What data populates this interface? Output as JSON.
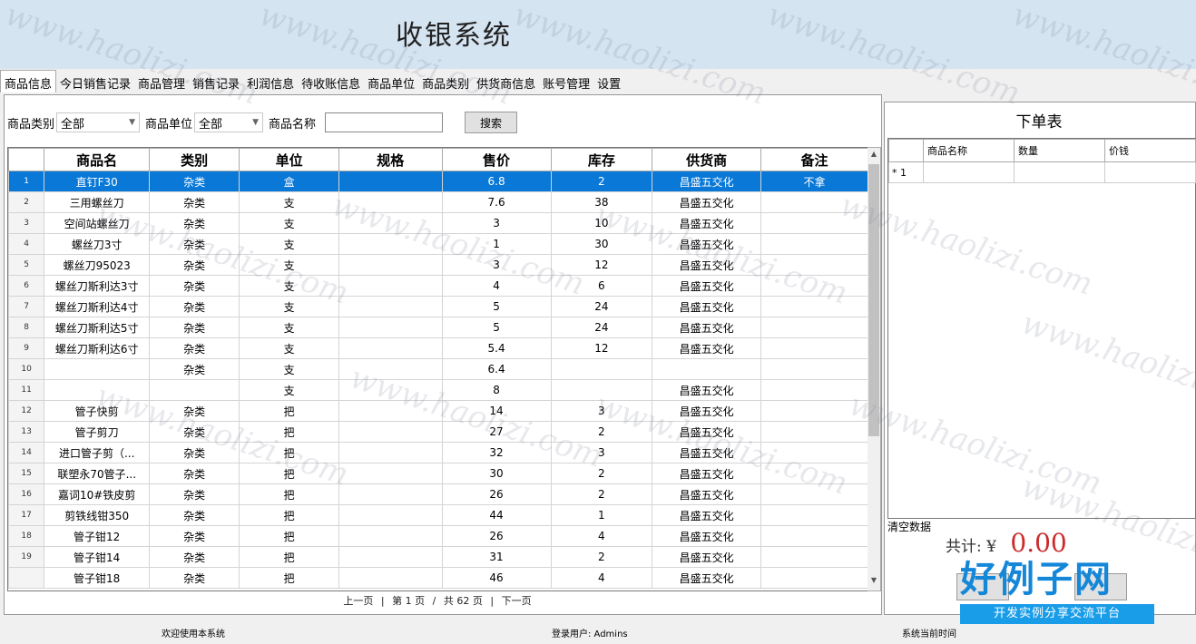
{
  "app": {
    "title": "收银系统"
  },
  "tabs": [
    "商品信息",
    "今日销售记录",
    "商品管理",
    "销售记录",
    "利润信息",
    "待收账信息",
    "商品单位",
    "商品类别",
    "供货商信息",
    "账号管理",
    "设置"
  ],
  "filter": {
    "category_label": "商品类别",
    "category_value": "全部",
    "unit_label": "商品单位",
    "unit_value": "全部",
    "name_label": "商品名称",
    "name_value": "",
    "search_button": "搜索"
  },
  "grid": {
    "columns": [
      "商品名",
      "类别",
      "单位",
      "规格",
      "售价",
      "库存",
      "供货商",
      "备注"
    ],
    "rows": [
      {
        "num": "1",
        "name": "直钉F30",
        "category": "杂类",
        "unit": "盒",
        "spec": "",
        "price": "6.8",
        "stock": "2",
        "supplier": "昌盛五交化",
        "note": "不拿",
        "selected": true
      },
      {
        "num": "2",
        "name": "三用螺丝刀",
        "category": "杂类",
        "unit": "支",
        "spec": "",
        "price": "7.6",
        "stock": "38",
        "supplier": "昌盛五交化",
        "note": ""
      },
      {
        "num": "3",
        "name": "空间站螺丝刀",
        "category": "杂类",
        "unit": "支",
        "spec": "",
        "price": "3",
        "stock": "10",
        "supplier": "昌盛五交化",
        "note": ""
      },
      {
        "num": "4",
        "name": "螺丝刀3寸",
        "category": "杂类",
        "unit": "支",
        "spec": "",
        "price": "1",
        "stock": "30",
        "supplier": "昌盛五交化",
        "note": ""
      },
      {
        "num": "5",
        "name": "螺丝刀95023",
        "category": "杂类",
        "unit": "支",
        "spec": "",
        "price": "3",
        "stock": "12",
        "supplier": "昌盛五交化",
        "note": ""
      },
      {
        "num": "6",
        "name": "螺丝刀斯利达3寸",
        "category": "杂类",
        "unit": "支",
        "spec": "",
        "price": "4",
        "stock": "6",
        "supplier": "昌盛五交化",
        "note": ""
      },
      {
        "num": "7",
        "name": "螺丝刀斯利达4寸",
        "category": "杂类",
        "unit": "支",
        "spec": "",
        "price": "5",
        "stock": "24",
        "supplier": "昌盛五交化",
        "note": ""
      },
      {
        "num": "8",
        "name": "螺丝刀斯利达5寸",
        "category": "杂类",
        "unit": "支",
        "spec": "",
        "price": "5",
        "stock": "24",
        "supplier": "昌盛五交化",
        "note": ""
      },
      {
        "num": "9",
        "name": "螺丝刀斯利达6寸",
        "category": "杂类",
        "unit": "支",
        "spec": "",
        "price": "5.4",
        "stock": "12",
        "supplier": "昌盛五交化",
        "note": ""
      },
      {
        "num": "10",
        "name": "",
        "category": "杂类",
        "unit": "支",
        "spec": "",
        "price": "6.4",
        "stock": "",
        "supplier": "",
        "note": ""
      },
      {
        "num": "11",
        "name": "",
        "category": "",
        "unit": "支",
        "spec": "",
        "price": "8",
        "stock": "",
        "supplier": "昌盛五交化",
        "note": ""
      },
      {
        "num": "12",
        "name": "管子快剪",
        "category": "杂类",
        "unit": "把",
        "spec": "",
        "price": "14",
        "stock": "3",
        "supplier": "昌盛五交化",
        "note": ""
      },
      {
        "num": "13",
        "name": "管子剪刀",
        "category": "杂类",
        "unit": "把",
        "spec": "",
        "price": "27",
        "stock": "2",
        "supplier": "昌盛五交化",
        "note": ""
      },
      {
        "num": "14",
        "name": "进口管子剪（...",
        "category": "杂类",
        "unit": "把",
        "spec": "",
        "price": "32",
        "stock": "3",
        "supplier": "昌盛五交化",
        "note": ""
      },
      {
        "num": "15",
        "name": "联塑永70管子...",
        "category": "杂类",
        "unit": "把",
        "spec": "",
        "price": "30",
        "stock": "2",
        "supplier": "昌盛五交化",
        "note": ""
      },
      {
        "num": "16",
        "name": "嘉词10#铁皮剪",
        "category": "杂类",
        "unit": "把",
        "spec": "",
        "price": "26",
        "stock": "2",
        "supplier": "昌盛五交化",
        "note": ""
      },
      {
        "num": "17",
        "name": "剪铁线钳350",
        "category": "杂类",
        "unit": "把",
        "spec": "",
        "price": "44",
        "stock": "1",
        "supplier": "昌盛五交化",
        "note": ""
      },
      {
        "num": "18",
        "name": "管子钳12",
        "category": "杂类",
        "unit": "把",
        "spec": "",
        "price": "26",
        "stock": "4",
        "supplier": "昌盛五交化",
        "note": ""
      },
      {
        "num": "19",
        "name": "管子钳14",
        "category": "杂类",
        "unit": "把",
        "spec": "",
        "price": "31",
        "stock": "2",
        "supplier": "昌盛五交化",
        "note": ""
      },
      {
        "num": "",
        "name": "管子钳18",
        "category": "杂类",
        "unit": "把",
        "spec": "",
        "price": "46",
        "stock": "4",
        "supplier": "昌盛五交化",
        "note": ""
      }
    ]
  },
  "pager": {
    "prev": "上一页",
    "first_part": "第",
    "page": "1",
    "page_word": "页",
    "total_part": "共",
    "total": "62",
    "next": "下一页"
  },
  "order": {
    "title": "下单表",
    "columns": [
      "商品名称",
      "数量",
      "价钱"
    ],
    "row_marker": "* 1",
    "clear_label": "清空数据",
    "total_label": "共计:",
    "currency": "¥",
    "total_value": "0.00"
  },
  "status": {
    "welcome": "欢迎使用本系统",
    "user": "登录用户: Admins",
    "time_label": "系统当前时间"
  },
  "watermark": {
    "text": "www.haolizi.com"
  },
  "logo": {
    "big": "好例子网",
    "small": "开发实例分享交流平台"
  },
  "colors": {
    "selected_row": "#0a78d7",
    "total": "#cc2b2b",
    "logo": "#1587d8"
  }
}
